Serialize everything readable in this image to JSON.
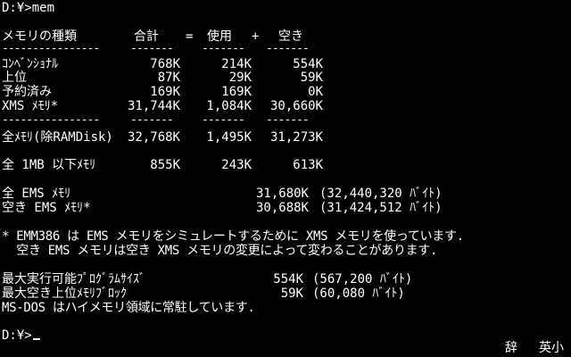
{
  "terminal": {
    "command_line": "D:¥>mem",
    "header": {
      "col_type": "メモリの種類",
      "col_total": "合計",
      "op_eq": "=",
      "col_used": "使用",
      "op_plus": "+",
      "col_free": "空き"
    },
    "separator": {
      "label": "----------------",
      "total": "-------",
      "used": "-------",
      "free": "-------"
    },
    "rows": [
      {
        "label": "ｺﾝﾍﾞﾝｼｮﾅﾙ",
        "total": "768K",
        "used": "214K",
        "free": "554K"
      },
      {
        "label": "上位",
        "total": "87K",
        "used": "29K",
        "free": "59K"
      },
      {
        "label": "予約済み",
        "total": "169K",
        "used": "169K",
        "free": "0K"
      },
      {
        "label": "XMS ﾒﾓﾘ*",
        "total": "31,744K",
        "used": "1,084K",
        "free": "30,660K"
      }
    ],
    "total_row": {
      "label": "全ﾒﾓﾘ(除RAMDisk)",
      "total": "32,768K",
      "used": "1,495K",
      "free": "31,273K"
    },
    "under_1mb_row": {
      "label": "全 1MB 以下ﾒﾓﾘ",
      "total": "855K",
      "used": "243K",
      "free": "613K"
    },
    "ems_rows": [
      {
        "label": "全 EMS ﾒﾓﾘ",
        "value": "31,680K",
        "bytes": "(32,440,320 ﾊﾞｲﾄ)"
      },
      {
        "label": "空き EMS ﾒﾓﾘ*",
        "value": "30,688K",
        "bytes": "(31,424,512 ﾊﾞｲﾄ)"
      }
    ],
    "note_line1": "* EMM386 は EMS メモリをシミュレートするために XMS メモリを使っています.",
    "note_line2": "  空き EMS メモリは空き XMS メモリの変更によって変わることがあります.",
    "max_rows": [
      {
        "label": "最大実行可能ﾌﾟﾛｸﾞﾗﾑｻｲｽﾞ",
        "value": "554K",
        "bytes": "(567,200 ﾊﾞｲﾄ)"
      },
      {
        "label": "最大空き上位ﾒﾓﾘﾌﾞﾛｯｸ",
        "value": "59K",
        "bytes": "(60,080 ﾊﾞｲﾄ)"
      }
    ],
    "resident_line": "MS-DOS はハイメモリ領域に常駐しています.",
    "prompt": "D:¥>"
  },
  "status_bar": {
    "dict": "辞",
    "mode": "英小"
  },
  "colors": {
    "background": "#000000",
    "text": "#ffffff"
  }
}
